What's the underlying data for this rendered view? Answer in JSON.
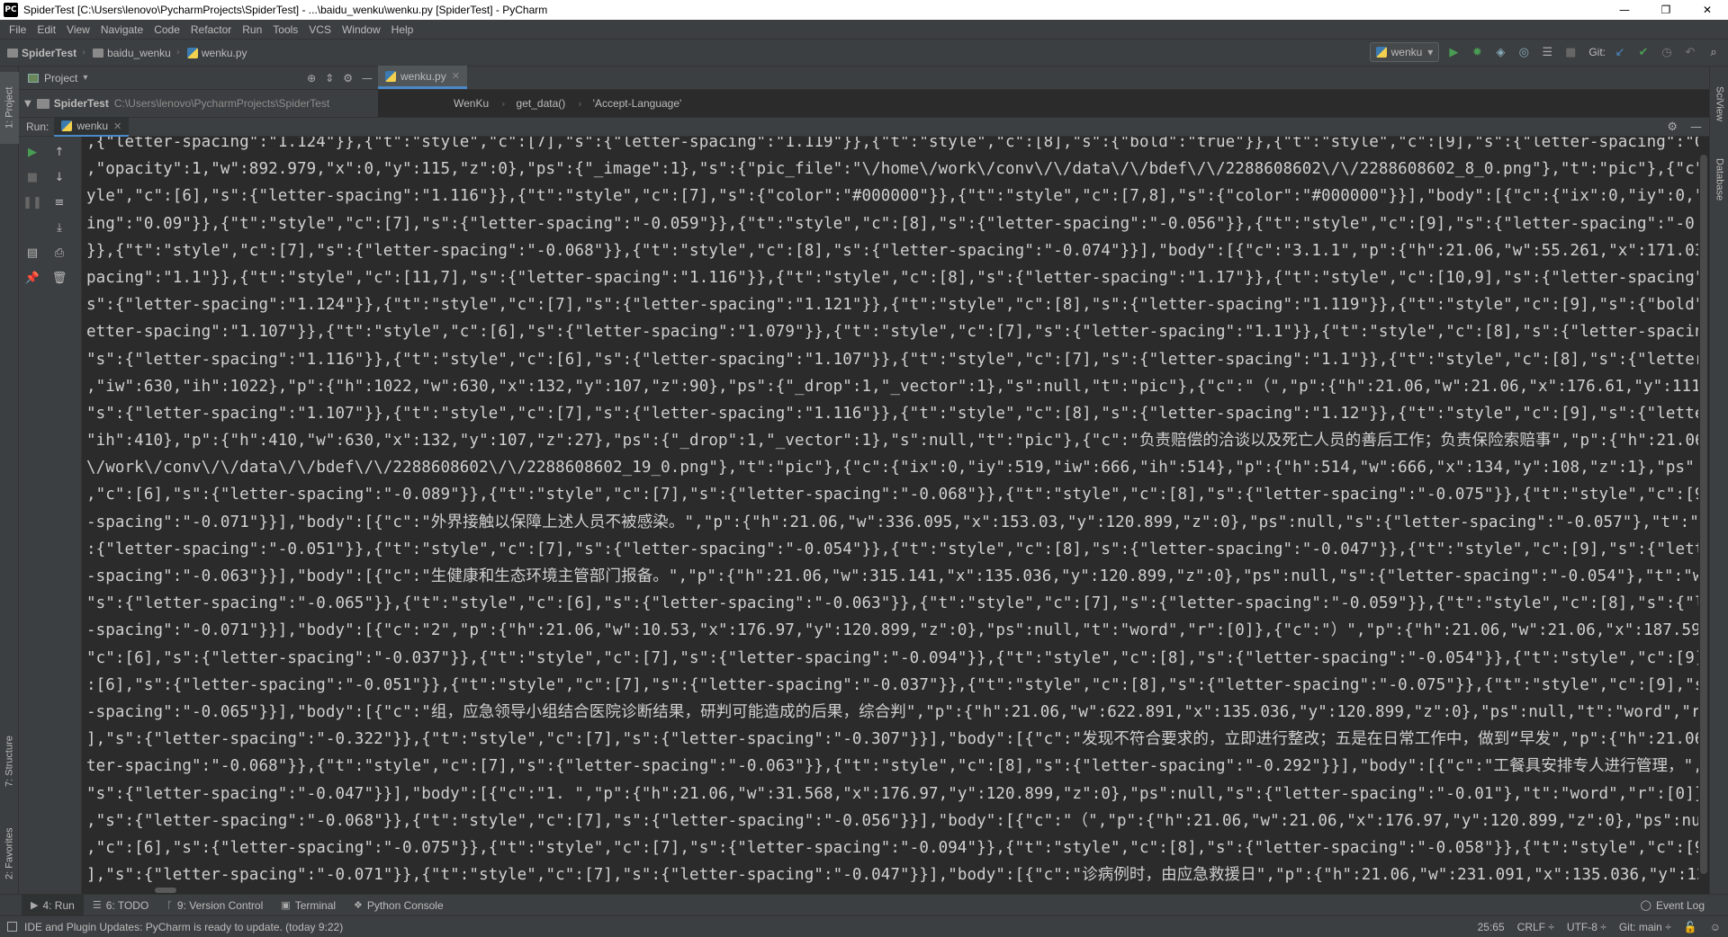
{
  "window": {
    "app_icon": "PC",
    "title": "SpiderTest [C:\\Users\\lenovo\\PycharmProjects\\SpiderTest] - ...\\baidu_wenku\\wenku.py [SpiderTest] - PyCharm",
    "minimize": "—",
    "maximize": "❐",
    "close": "✕"
  },
  "menu": [
    "File",
    "Edit",
    "View",
    "Navigate",
    "Code",
    "Refactor",
    "Run",
    "Tools",
    "VCS",
    "Window",
    "Help"
  ],
  "nav": {
    "crumbs": [
      "SpiderTest",
      "baidu_wenku",
      "wenku.py"
    ],
    "run_config": "wenku",
    "run_config_arrow": "▾",
    "git_label": "Git:"
  },
  "left_stripe": {
    "project": "1: Project",
    "structure": "7: Structure",
    "favorites": "2: Favorites"
  },
  "right_stripe": {
    "sciview": "SciView",
    "database": "Database"
  },
  "project_panel": {
    "title": "Project",
    "dropdown": "▾",
    "root_name": "SpiderTest",
    "root_path": "C:\\Users\\lenovo\\PycharmProjects\\SpiderTest"
  },
  "editor": {
    "tab_label": "wenku.py",
    "tab_close": "✕",
    "breadcrumbs": [
      "WenKu",
      "get_data()",
      "'Accept-Language'"
    ]
  },
  "run_panel": {
    "label": "Run:",
    "tab_label": "wenku",
    "tab_close": "✕"
  },
  "console": {
    "lines": [
      ",{\"letter-spacing\":\"1.124\"}},{\"t\":\"style\",\"c\":[7],\"s\":{\"letter-spacing\":\"1.119\"}},{\"t\":\"style\",\"c\":[8],\"s\":{\"bold\":\"true\"}},{\"t\":\"style\",\"c\":[9],\"s\":{\"letter-spacing\":\"0.629\"}}],",
      ",\"opacity\":1,\"w\":892.979,\"x\":0,\"y\":115,\"z\":0},\"ps\":{\"_image\":1},\"s\":{\"pic_file\":\"\\/home\\/work\\/conv\\/\\/data\\/\\/bdef\\/\\/2288608602\\/\\/2288608602_8_0.png\"},\"t\":\"pic\"},{\"c\":{\"ix\":0,\"i",
      "yle\",\"c\":[6],\"s\":{\"letter-spacing\":\"1.116\"}},{\"t\":\"style\",\"c\":[7],\"s\":{\"color\":\"#000000\"}},{\"t\":\"style\",\"c\":[7,8],\"s\":{\"color\":\"#000000\"}}],\"body\":[{\"c\":{\"ix\":0,\"iy\":0,\"iw\":893,\"ih",
      "ing\":\"0.09\"}},{\"t\":\"style\",\"c\":[7],\"s\":{\"letter-spacing\":\"-0.059\"}},{\"t\":\"style\",\"c\":[8],\"s\":{\"letter-spacing\":\"-0.056\"}},{\"t\":\"style\",\"c\":[9],\"s\":{\"letter-spacing\":\"-0.322\"}},{",
      "}},{\"t\":\"style\",\"c\":[7],\"s\":{\"letter-spacing\":\"-0.068\"}},{\"t\":\"style\",\"c\":[8],\"s\":{\"letter-spacing\":\"-0.074\"}}],\"body\":[{\"c\":\"3.1.1\",\"p\":{\"h\":21.06,\"w\":55.261,\"x\":171.03,\"y\":120.89",
      "pacing\":\"1.1\"}},{\"t\":\"style\",\"c\":[11,7],\"s\":{\"letter-spacing\":\"1.116\"}},{\"t\":\"style\",\"c\":[8],\"s\":{\"letter-spacing\":\"1.17\"}},{\"t\":\"style\",\"c\":[10,9],\"s\":{\"letter-spacing\":\"1.079\"}},",
      "s\":{\"letter-spacing\":\"1.124\"}},{\"t\":\"style\",\"c\":[7],\"s\":{\"letter-spacing\":\"1.121\"}},{\"t\":\"style\",\"c\":[8],\"s\":{\"letter-spacing\":\"1.119\"}},{\"t\":\"style\",\"c\":[9],\"s\":{\"bold\":\"true\"}}],",
      "etter-spacing\":\"1.107\"}},{\"t\":\"style\",\"c\":[6],\"s\":{\"letter-spacing\":\"1.079\"}},{\"t\":\"style\",\"c\":[7],\"s\":{\"letter-spacing\":\"1.1\"}},{\"t\":\"style\",\"c\":[8],\"s\":{\"letter-spacing\":\"0.629\"}",
      "\"s\":{\"letter-spacing\":\"1.116\"}},{\"t\":\"style\",\"c\":[6],\"s\":{\"letter-spacing\":\"1.107\"}},{\"t\":\"style\",\"c\":[7],\"s\":{\"letter-spacing\":\"1.1\"}},{\"t\":\"style\",\"c\":[8],\"s\":{\"letter-spacing\":",
      ",\"iw\":630,\"ih\":1022},\"p\":{\"h\":1022,\"w\":630,\"x\":132,\"y\":107,\"z\":90},\"ps\":{\"_drop\":1,\"_vector\":1},\"s\":null,\"t\":\"pic\"},{\"c\":\"（\",\"p\":{\"h\":21.06,\"w\":21.06,\"x\":176.61,\"y\":111.149,\"z\":91",
      "\"s\":{\"letter-spacing\":\"1.107\"}},{\"t\":\"style\",\"c\":[7],\"s\":{\"letter-spacing\":\"1.116\"}},{\"t\":\"style\",\"c\":[8],\"s\":{\"letter-spacing\":\"1.12\"}},{\"t\":\"style\",\"c\":[9],\"s\":{\"letter-spacing\"",
      "\"ih\":410},\"p\":{\"h\":410,\"w\":630,\"x\":132,\"y\":107,\"z\":27},\"ps\":{\"_drop\":1,\"_vector\":1},\"s\":null,\"t\":\"pic\"},{\"c\":\"负责赔偿的洽谈以及死亡人员的善后工作；负责保险索赔事\",\"p\":{\"h\":21.06,",
      "\\/work\\/conv\\/\\/data\\/\\/bdef\\/\\/2288608602\\/\\/2288608602_19_0.png\"},\"t\":\"pic\"},{\"c\":{\"ix\":0,\"iy\":519,\"iw\":666,\"ih\":514},\"p\":{\"h\":514,\"w\":666,\"x\":134,\"y\":108,\"z\":1},\"ps\":{\"_drop\":1,",
      ",\"c\":[6],\"s\":{\"letter-spacing\":\"-0.089\"}},{\"t\":\"style\",\"c\":[7],\"s\":{\"letter-spacing\":\"-0.068\"}},{\"t\":\"style\",\"c\":[8],\"s\":{\"letter-spacing\":\"-0.075\"}},{\"t\":\"style\",\"c\":[9],\"s\":{\"let",
      "-spacing\":\"-0.071\"}}],\"body\":[{\"c\":\"外界接触以保障上述人员不被感染。\",\"p\":{\"h\":21.06,\"w\":336.095,\"x\":153.03,\"y\":120.899,\"z\":0},\"ps\":null,\"s\":{\"letter-spacing\":\"-0.057\"},\"t\":\"word\",",
      ":{\"letter-spacing\":\"-0.051\"}},{\"t\":\"style\",\"c\":[7],\"s\":{\"letter-spacing\":\"-0.054\"}},{\"t\":\"style\",\"c\":[8],\"s\":{\"letter-spacing\":\"-0.047\"}},{\"t\":\"style\",\"c\":[9],\"s\":{\"letter-spacing",
      "-spacing\":\"-0.063\"}}],\"body\":[{\"c\":\"生健康和生态环境主管部门报备。\",\"p\":{\"h\":21.06,\"w\":315.141,\"x\":135.036,\"y\":120.899,\"z\":0},\"ps\":null,\"s\":{\"letter-spacing\":\"-0.054\"},\"t\":\"word\",",
      "\"s\":{\"letter-spacing\":\"-0.065\"}},{\"t\":\"style\",\"c\":[6],\"s\":{\"letter-spacing\":\"-0.063\"}},{\"t\":\"style\",\"c\":[7],\"s\":{\"letter-spacing\":\"-0.059\"}},{\"t\":\"style\",\"c\":[8],\"s\":{\"letter-spaci",
      "-spacing\":\"-0.071\"}}],\"body\":[{\"c\":\"2\",\"p\":{\"h\":21.06,\"w\":10.53,\"x\":176.97,\"y\":120.899,\"z\":0},\"ps\":null,\"t\":\"word\",\"r\":[0]},{\"c\":\"）\",\"p\":{\"h\":21.06,\"w\":21.06,\"x\":187.59,\"y\":120.89",
      "\"c\":[6],\"s\":{\"letter-spacing\":\"-0.037\"}},{\"t\":\"style\",\"c\":[7],\"s\":{\"letter-spacing\":\"-0.094\"}},{\"t\":\"style\",\"c\":[8],\"s\":{\"letter-spacing\":\"-0.054\"}},{\"t\":\"style\",\"c\":[9],\"s\":{\"le",
      ":[6],\"s\":{\"letter-spacing\":\"-0.051\"}},{\"t\":\"style\",\"c\":[7],\"s\":{\"letter-spacing\":\"-0.037\"}},{\"t\":\"style\",\"c\":[8],\"s\":{\"letter-spacing\":\"-0.075\"}},{\"t\":\"style\",\"c\":[9],\"s\":{\"bold\"",
      "-spacing\":\"-0.065\"}}],\"body\":[{\"c\":\"组，应急领导小组结合医院诊断结果，研判可能造成的后果，综合判\",\"p\":{\"h\":21.06,\"w\":622.891,\"x\":135.036,\"y\":120.899,\"z\":0},\"ps\":null,\"t\":\"word\",\"r",
      "],\"s\":{\"letter-spacing\":\"-0.322\"}},{\"t\":\"style\",\"c\":[7],\"s\":{\"letter-spacing\":\"-0.307\"}}],\"body\":[{\"c\":\"发现不符合要求的，立即进行整改；五是在日常工作中，做到“早发\",\"p\":{\"h\":21.06",
      "ter-spacing\":\"-0.068\"}},{\"t\":\"style\",\"c\":[7],\"s\":{\"letter-spacing\":\"-0.063\"}},{\"t\":\"style\",\"c\":[8],\"s\":{\"letter-spacing\":\"-0.292\"}}],\"body\":[{\"c\":\"工餐具安排专人进行管理，\",\"p\":{\"h",
      "\"s\":{\"letter-spacing\":\"-0.047\"}}],\"body\":[{\"c\":\"1. \",\"p\":{\"h\":21.06,\"w\":31.568,\"x\":176.97,\"y\":120.899,\"z\":0},\"ps\":null,\"s\":{\"letter-spacing\":\"-0.01\"},\"t\":\"word\",\"r\":[0]},{\"c\":\"较大",
      ",\"s\":{\"letter-spacing\":\"-0.068\"}},{\"t\":\"style\",\"c\":[7],\"s\":{\"letter-spacing\":\"-0.056\"}}],\"body\":[{\"c\":\"（\",\"p\":{\"h\":21.06,\"w\":21.06,\"x\":176.97,\"y\":120.899,\"z\":0},\"ps\":null,\"t\":\"wor",
      ",\"c\":[6],\"s\":{\"letter-spacing\":\"-0.075\"}},{\"t\":\"style\",\"c\":[7],\"s\":{\"letter-spacing\":\"-0.094\"}},{\"t\":\"style\",\"c\":[8],\"s\":{\"letter-spacing\":\"-0.058\"}},{\"t\":\"style\",\"c\":[9],\"s\":{\"let",
      "],\"s\":{\"letter-spacing\":\"-0.071\"}},{\"t\":\"style\",\"c\":[7],\"s\":{\"letter-spacing\":\"-0.047\"}}],\"body\":[{\"c\":\"诊病例时，由应急救援日\",\"p\":{\"h\":21.06,\"w\":231.091,\"x\":135.036,\"y\":120.899,"
    ]
  },
  "bottom_tabs": [
    {
      "label": "4: Run",
      "icon": "run-icon",
      "glyph": "▶"
    },
    {
      "label": "6: TODO",
      "icon": "todo-icon",
      "glyph": "☰"
    },
    {
      "label": "9: Version Control",
      "icon": "vcs-icon",
      "glyph": "ᚴ"
    },
    {
      "label": "Terminal",
      "icon": "terminal-icon",
      "glyph": "▣"
    },
    {
      "label": "Python Console",
      "icon": "python-console-icon",
      "glyph": "❖"
    }
  ],
  "event_log": "Event Log",
  "status": {
    "message": "IDE and Plugin Updates: PyCharm is ready to update. (today 9:22)",
    "position": "25:65",
    "line_sep": "CRLF ÷",
    "encoding": "UTF-8 ÷",
    "git": "Git: main ÷"
  },
  "colors": {
    "background": "#2b2b2b",
    "panel": "#3c3f41",
    "accent": "#4a88c7",
    "run_green": "#499c54"
  }
}
